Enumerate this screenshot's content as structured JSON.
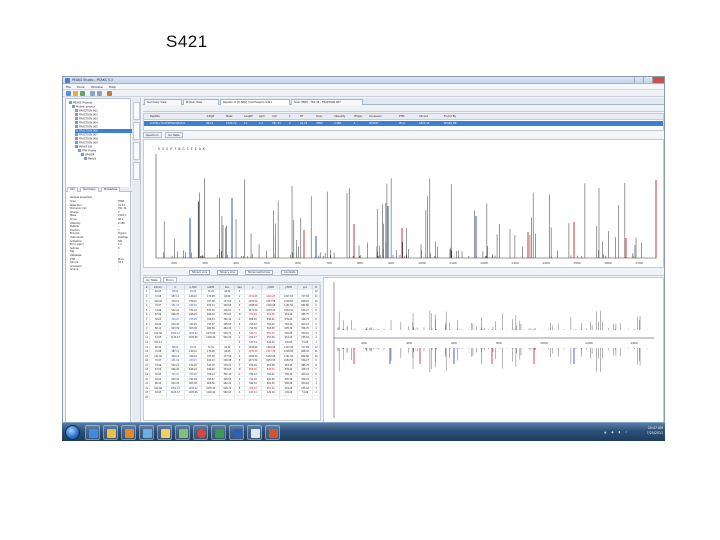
{
  "slide": {
    "title": "S421"
  },
  "window": {
    "title": "PEAKS Studio - PEAKS 5.3"
  },
  "menu": [
    "File",
    "Tools",
    "Window",
    "Help"
  ],
  "left_panel": {
    "tree": [
      "PEAKS Projects",
      "Protein project",
      "FRACTION 001",
      "FRACTION 002",
      "FRACTION 003",
      "FRACTION 004",
      "FRACTION 005",
      "FRACTION 006",
      "FRACTION 007",
      "FRACTION 008",
      "FRACTION 009",
      "PEAKS DB",
      "PTM Profile",
      "SPIDER",
      "Result"
    ],
    "tabs": [
      "Info",
      "Summary",
      "Properties"
    ],
    "props_title": "Sample properties",
    "props": [
      [
        "Scan",
        "3580"
      ],
      [
        "Retention",
        "41.23"
      ],
      [
        "Precursor m/z",
        "761.34"
      ],
      [
        "Charge",
        "2"
      ],
      [
        "Mass",
        "1520.7"
      ],
      [
        "Score",
        "96.1"
      ],
      [
        "Intensity",
        "2.1E6"
      ],
      [
        "Peptide",
        "-"
      ],
      [
        "Fraction",
        "7"
      ],
      [
        "Enzyme",
        "Trypsin"
      ],
      [
        "Instrument",
        "Orbitrap"
      ],
      [
        "Activation",
        "CID"
      ],
      [
        "Error (ppm)",
        "1.2"
      ],
      [
        "Isotope",
        "0"
      ],
      [
        "Tag",
        "-"
      ],
      [
        "Database",
        "-"
      ],
      [
        "PTM",
        "Phos"
      ],
      [
        "AScore",
        "34.2"
      ],
      [
        "Accession",
        "-"
      ],
      [
        "Source",
        "-"
      ]
    ]
  },
  "doc_tabs": [
    "Summary View",
    "Protein View",
    "Peptide: R.[D-SER]-7-N-Phospho-S421",
    "Scan 3580 - 761.34 - FRACTION 007"
  ],
  "psm": {
    "headers": [
      "Peptide",
      "-10lgP",
      "Mass",
      "Length",
      "ppm",
      "m/z",
      "z",
      "RT",
      "Scan",
      "Intensity",
      "#Spec",
      "Accession",
      "PTM",
      "AScore",
      "Found By"
    ],
    "row": [
      "K.SVS(+79.97)PTNGSIEAK.R",
      "96.11",
      "1520.70",
      "12",
      "1.2",
      "761.34",
      "2",
      "41.23",
      "3580",
      "2.1E6",
      "1",
      "P04637",
      "Phos",
      "S421:34",
      "PEAKS DB"
    ]
  },
  "spectrum_tabs": [
    "Spectrum",
    "Ion Table"
  ],
  "spectrum": {
    "sequence": "S V S P T N G S I E A K",
    "xlabel": "m/z",
    "ticks": [
      "200",
      "300",
      "400",
      "500",
      "600",
      "700",
      "800",
      "900",
      "1000",
      "1100",
      "1200",
      "1300",
      "1400",
      "1500",
      "1600",
      "1700"
    ]
  },
  "controls": [
    "Show b ions",
    "Show y ions",
    "Show neutral loss",
    "Annotate"
  ],
  "fragment_tabs": [
    "Ion Table",
    "Errors"
  ],
  "fragment_table": {
    "headers": [
      "#",
      "Immon.",
      "b",
      "b-H2O",
      "b-NH3",
      "b2+",
      "Seq",
      "y",
      "y-H2O",
      "y-NH3",
      "y2+",
      "#"
    ],
    "rows": [
      [
        "1",
        "60.04",
        "88.04",
        "70.03",
        "71.01",
        "44.52",
        "S",
        "",
        "",
        "",
        "",
        "12"
      ],
      [
        "2",
        "72.08",
        "187.11",
        "169.10",
        "170.08",
        "94.06",
        "V",
        "1434.66",
        "1416.65",
        "1417.63",
        "717.83",
        "11"
      ],
      [
        "3",
        "140.00",
        "354.11",
        "336.10",
        "337.08",
        "177.56",
        "S",
        "1335.59",
        "1317.58",
        "1318.56",
        "668.30",
        "10"
      ],
      [
        "4",
        "70.07",
        "451.16",
        "433.15",
        "434.13",
        "226.08",
        "P",
        "1168.59",
        "1150.58",
        "1151.56",
        "584.80",
        "9"
      ],
      [
        "5",
        "74.06",
        "552.21",
        "534.20",
        "535.18",
        "276.61",
        "T",
        "1071.54",
        "1053.53",
        "1054.51",
        "536.27",
        "8"
      ],
      [
        "6",
        "87.06",
        "666.25",
        "648.24",
        "649.22",
        "333.63",
        "N",
        "970.49",
        "952.48",
        "953.46",
        "485.75",
        "7"
      ],
      [
        "7",
        "30.03",
        "723.27",
        "705.26",
        "706.24",
        "362.14",
        "G",
        "856.45",
        "838.44",
        "839.42",
        "428.73",
        "6"
      ],
      [
        "8",
        "60.04",
        "810.30",
        "792.29",
        "793.27",
        "405.65",
        "S",
        "799.43",
        "781.42",
        "782.40",
        "400.22",
        "5"
      ],
      [
        "9",
        "86.10",
        "923.39",
        "905.38",
        "906.36",
        "462.20",
        "I",
        "712.39",
        "694.38",
        "695.36",
        "356.70",
        "4"
      ],
      [
        "10",
        "102.06",
        "1052.43",
        "1034.42",
        "1035.40",
        "526.72",
        "E",
        "599.31",
        "581.30",
        "582.28",
        "300.16",
        "3"
      ],
      [
        "11",
        "44.05",
        "1123.47",
        "1105.46",
        "1106.44",
        "562.24",
        "A",
        "470.27",
        "452.26",
        "453.24",
        "235.64",
        "2"
      ],
      [
        "12",
        "101.11",
        "",
        "",
        "",
        "",
        "K",
        "147.11",
        "129.10",
        "130.09",
        "74.06",
        "1"
      ],
      [
        "13",
        "60.04",
        "88.04",
        "70.03",
        "71.01",
        "44.52",
        "S",
        "1434.66",
        "1416.65",
        "1417.63",
        "717.83",
        "12"
      ],
      [
        "14",
        "72.08",
        "187.11",
        "169.10",
        "170.08",
        "94.06",
        "V",
        "1335.59",
        "1317.58",
        "1318.56",
        "668.30",
        "11"
      ],
      [
        "15",
        "140.00",
        "354.11",
        "336.10",
        "337.08",
        "177.56",
        "S",
        "1168.59",
        "1150.58",
        "1151.56",
        "584.80",
        "10"
      ],
      [
        "16",
        "70.07",
        "451.16",
        "433.15",
        "434.13",
        "226.08",
        "P",
        "1071.54",
        "1053.53",
        "1054.51",
        "536.27",
        "9"
      ],
      [
        "17",
        "74.06",
        "552.21",
        "534.20",
        "535.18",
        "276.61",
        "T",
        "970.49",
        "952.48",
        "953.46",
        "485.75",
        "8"
      ],
      [
        "18",
        "87.06",
        "666.25",
        "648.24",
        "649.22",
        "333.63",
        "N",
        "856.45",
        "838.44",
        "839.42",
        "428.73",
        "7"
      ],
      [
        "19",
        "30.03",
        "723.27",
        "705.26",
        "706.24",
        "362.14",
        "G",
        "799.43",
        "781.42",
        "782.40",
        "400.22",
        "6"
      ],
      [
        "20",
        "60.04",
        "810.30",
        "792.29",
        "793.27",
        "405.65",
        "S",
        "712.39",
        "694.38",
        "695.36",
        "356.70",
        "5"
      ],
      [
        "21",
        "86.10",
        "923.39",
        "905.38",
        "906.36",
        "462.20",
        "I",
        "599.31",
        "581.30",
        "582.28",
        "300.16",
        "4"
      ],
      [
        "22",
        "102.06",
        "1052.43",
        "1034.42",
        "1035.40",
        "526.72",
        "E",
        "470.27",
        "452.26",
        "453.24",
        "235.64",
        "3"
      ],
      [
        "23",
        "44.05",
        "1123.47",
        "1105.46",
        "1106.44",
        "562.24",
        "A",
        "147.11",
        "129.10",
        "130.09",
        "74.06",
        "2"
      ],
      [
        "24",
        "",
        "",
        "",
        "",
        "",
        "",
        "",
        "",
        "",
        "",
        ""
      ]
    ]
  },
  "mirror": {
    "ticks": [
      "200",
      "400",
      "600",
      "800",
      "1000",
      "1200",
      "1400"
    ]
  },
  "taskbar": {
    "time": "10:47 AM",
    "date": "7/25/2011"
  },
  "colors": {
    "b_ion": "#1a3fb0",
    "y_ion": "#c02020",
    "selection": "#3d7fd6"
  }
}
